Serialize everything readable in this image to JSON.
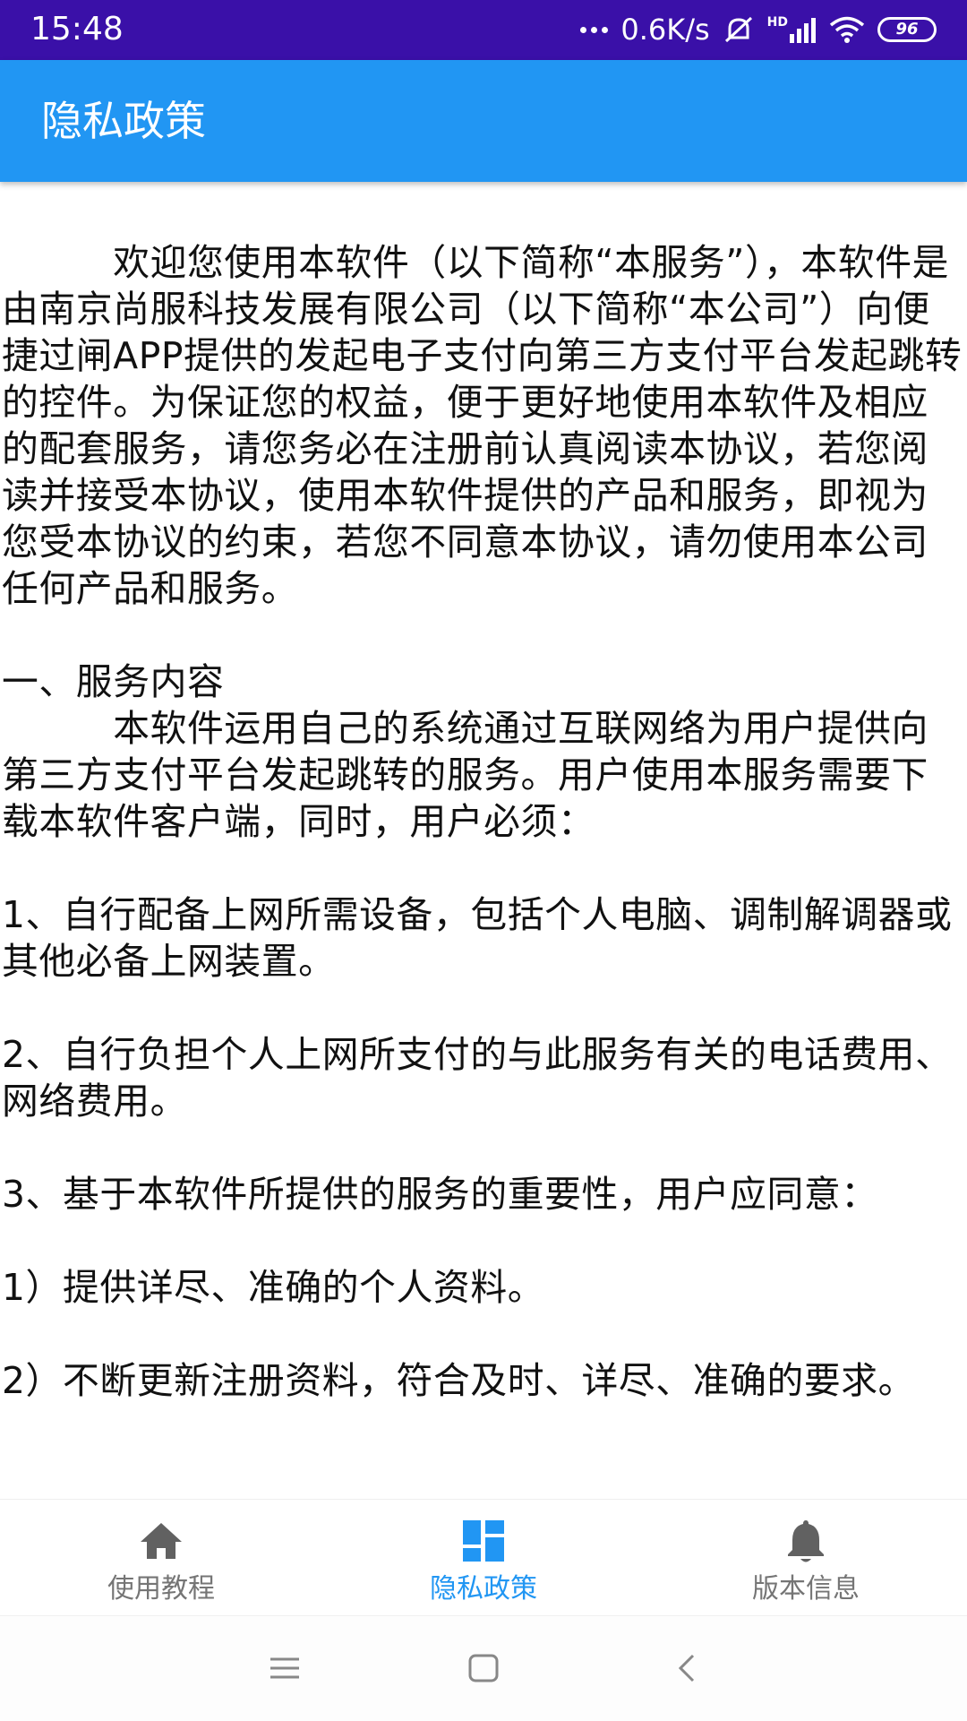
{
  "status_bar": {
    "time": "15:48",
    "network_speed": "0.6K/s",
    "network_type": "HD",
    "battery": "96"
  },
  "app_bar": {
    "title": "隐私政策"
  },
  "content": {
    "text": "　　　欢迎您使用本软件（以下简称“本服务”），本软件是由南京尚服科技发展有限公司（以下简称“本公司”）向便捷过闸APP提供的发起电子支付向第三方支付平台发起跳转的控件。为保证您的权益，便于更好地使用本软件及相应的配套服务，请您务必在注册前认真阅读本协议，若您阅读并接受本协议，使用本软件提供的产品和服务，即视为您受本协议的约束，若您不同意本协议，请勿使用本公司任何产品和服务。\n\n一、服务内容\n　　　本软件运用自己的系统通过互联网络为用户提供向第三方支付平台发起跳转的服务。用户使用本服务需要下载本软件客户端，同时，用户必须：\n\n1、自行配备上网所需设备，包括个人电脑、调制解调器或其他必备上网装置。\n\n2、自行负担个人上网所支付的与此服务有关的电话费用、网络费用。\n\n3、基于本软件所提供的服务的重要性，用户应同意：\n\n1）提供详尽、准确的个人资料。\n\n2）不断更新注册资料，符合及时、详尽、准确的要求。"
  },
  "bottom_nav": {
    "items": [
      {
        "label": "使用教程",
        "icon": "home-icon",
        "active": false
      },
      {
        "label": "隐私政策",
        "icon": "dashboard-icon",
        "active": true
      },
      {
        "label": "版本信息",
        "icon": "bell-icon",
        "active": false
      }
    ]
  },
  "colors": {
    "status_bar": "#3a10a8",
    "app_bar": "#2196f3",
    "active": "#2196f3",
    "inactive": "#757575"
  },
  "system_nav": {
    "icons": [
      "menu-icon",
      "home-square-icon",
      "back-icon"
    ]
  }
}
